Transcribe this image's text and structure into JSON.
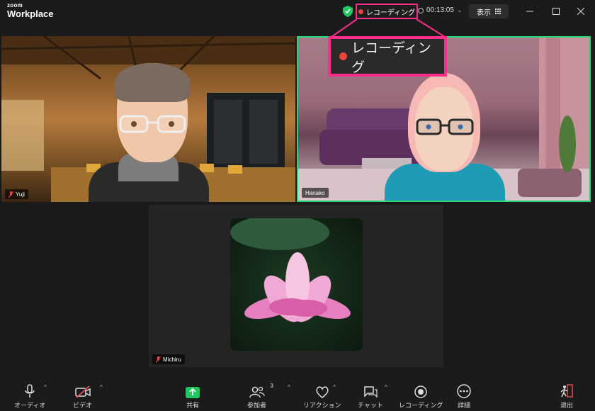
{
  "app": {
    "brand_small": "zoom",
    "brand_big": "Workplace"
  },
  "header": {
    "recording_label": "レコーディング",
    "timer": "00:13:05",
    "view_label": "表示"
  },
  "callout": {
    "label": "レコーディング"
  },
  "participants": [
    {
      "name": "Yuji",
      "muted": true
    },
    {
      "name": "Hanako",
      "muted": false,
      "active_speaker": true
    },
    {
      "name": "Michiru",
      "muted": true
    }
  ],
  "toolbar": {
    "audio": "オーディオ",
    "video": "ビデオ",
    "share": "共有",
    "participants": "参加者",
    "participant_count": "3",
    "reactions": "リアクション",
    "chat": "チャット",
    "record": "レコーディング",
    "more": "詳細",
    "leave": "退出"
  },
  "colors": {
    "accent_highlight": "#ff2d8a",
    "active_speaker_border": "#2bd67b",
    "share_green": "#22c55e",
    "rec_red": "#e8453c",
    "leave_red": "#e5484d"
  }
}
